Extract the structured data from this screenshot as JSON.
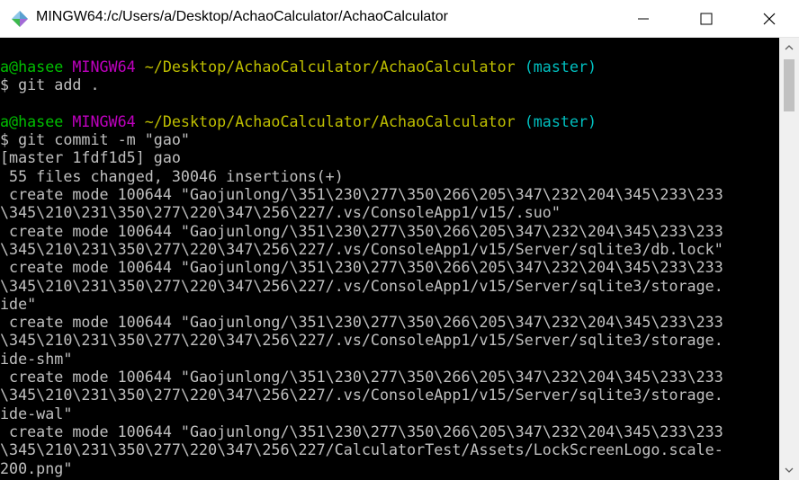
{
  "window": {
    "title": "MINGW64:/c/Users/a/Desktop/AchaoCalculator/AchaoCalculator"
  },
  "titlebar_icons": {
    "app": "diamond-icon",
    "minimize": "minimize-icon",
    "maximize": "maximize-icon",
    "close": "close-icon"
  },
  "prompt1": {
    "user": "a@hasee",
    "env": "MINGW64",
    "path": "~/Desktop/AchaoCalculator/AchaoCalculator",
    "branch": "(master)"
  },
  "cmd1": "$ git add .",
  "prompt2": {
    "user": "a@hasee",
    "env": "MINGW64",
    "path": "~/Desktop/AchaoCalculator/AchaoCalculator",
    "branch": "(master)"
  },
  "cmd2": "$ git commit -m \"gao\"",
  "output": [
    "[master 1fdf1d5] gao",
    " 55 files changed, 30046 insertions(+)",
    " create mode 100644 \"Gaojunlong/\\351\\230\\277\\350\\266\\205\\347\\232\\204\\345\\233\\233",
    "\\345\\210\\231\\350\\277\\220\\347\\256\\227/.vs/ConsoleApp1/v15/.suo\"",
    " create mode 100644 \"Gaojunlong/\\351\\230\\277\\350\\266\\205\\347\\232\\204\\345\\233\\233",
    "\\345\\210\\231\\350\\277\\220\\347\\256\\227/.vs/ConsoleApp1/v15/Server/sqlite3/db.lock\"",
    " create mode 100644 \"Gaojunlong/\\351\\230\\277\\350\\266\\205\\347\\232\\204\\345\\233\\233",
    "\\345\\210\\231\\350\\277\\220\\347\\256\\227/.vs/ConsoleApp1/v15/Server/sqlite3/storage.",
    "ide\"",
    " create mode 100644 \"Gaojunlong/\\351\\230\\277\\350\\266\\205\\347\\232\\204\\345\\233\\233",
    "\\345\\210\\231\\350\\277\\220\\347\\256\\227/.vs/ConsoleApp1/v15/Server/sqlite3/storage.",
    "ide-shm\"",
    " create mode 100644 \"Gaojunlong/\\351\\230\\277\\350\\266\\205\\347\\232\\204\\345\\233\\233",
    "\\345\\210\\231\\350\\277\\220\\347\\256\\227/.vs/ConsoleApp1/v15/Server/sqlite3/storage.",
    "ide-wal\"",
    " create mode 100644 \"Gaojunlong/\\351\\230\\277\\350\\266\\205\\347\\232\\204\\345\\233\\233",
    "\\345\\210\\231\\350\\277\\220\\347\\256\\227/CalculatorTest/Assets/LockScreenLogo.scale-",
    "200.png\""
  ],
  "colors": {
    "background": "#000000",
    "text": "#c0c0c0",
    "user": "#00bf00",
    "env": "#bf00bf",
    "path": "#bfbf00",
    "branch": "#00bfbf"
  },
  "scrollbar": {
    "up": "scroll-up-icon",
    "down": "scroll-down-icon"
  }
}
